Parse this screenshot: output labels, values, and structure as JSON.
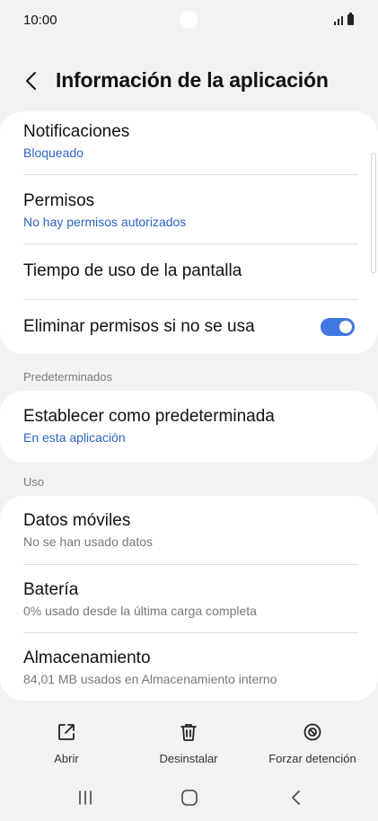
{
  "status_bar": {
    "time": "10:00"
  },
  "header": {
    "title": "Información de la aplicación"
  },
  "card1": {
    "notifications": {
      "title": "Notificaciones",
      "subtitle": "Bloqueado"
    },
    "permissions": {
      "title": "Permisos",
      "subtitle": "No hay permisos autorizados"
    },
    "screen_time": {
      "title": "Tiempo de uso de la pantalla"
    },
    "remove_permissions": {
      "title": "Eliminar permisos si no se usa",
      "toggle_on": true
    }
  },
  "defaults_section": {
    "label": "Predeterminados",
    "set_default": {
      "title": "Establecer como predeterminada",
      "subtitle": "En esta aplicación"
    }
  },
  "usage_section": {
    "label": "Uso",
    "mobile_data": {
      "title": "Datos móviles",
      "subtitle": "No se han usado datos"
    },
    "battery": {
      "title": "Batería",
      "subtitle": "0% usado desde la última carga completa"
    },
    "storage": {
      "title": "Almacenamiento",
      "subtitle": "84,01 MB usados en Almacenamiento interno"
    }
  },
  "bottom_actions": {
    "open": "Abrir",
    "uninstall": "Desinstalar",
    "force_stop": "Forzar detención"
  },
  "colors": {
    "accent": "#3f78e0",
    "link_blue": "#2f62c5",
    "background": "#f2f2f4",
    "card": "#ffffff"
  },
  "icons": {
    "back": "chevron-left-icon",
    "open": "external-open-icon",
    "uninstall": "trash-icon",
    "force_stop": "block-icon",
    "nav_recents": "recents-icon",
    "nav_home": "home-icon",
    "nav_back": "back-nav-icon"
  }
}
